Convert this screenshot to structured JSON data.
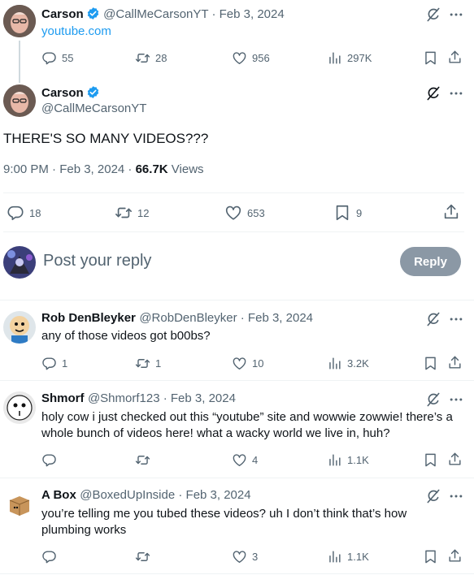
{
  "colors": {
    "accent": "#1d9bf0",
    "muted": "#536471",
    "text": "#0f1419",
    "reply_button": "#8b98a5"
  },
  "parent_tweet": {
    "author_name": "Carson",
    "meta": "@CallMeCarsonYT · Feb 3, 2024",
    "text": "youtube.com",
    "replies": "55",
    "retweets": "28",
    "likes": "956",
    "views": "297K"
  },
  "main_tweet": {
    "author_name": "Carson",
    "handle": "@CallMeCarsonYT",
    "text": "THERE'S SO MANY VIDEOS???",
    "timestamp": "9:00 PM · Feb 3, 2024 · ",
    "views_count": "66.7K",
    "views_label": " Views",
    "replies": "18",
    "retweets": "12",
    "likes": "653",
    "bookmarks": "9"
  },
  "composer": {
    "placeholder": "Post your reply",
    "button_label": "Reply"
  },
  "replies": [
    {
      "author_name": "Rob DenBleyker",
      "meta": "@RobDenBleyker · Feb 3, 2024",
      "text": "any of those videos got b00bs?",
      "replies": "1",
      "retweets": "1",
      "likes": "10",
      "views": "3.2K"
    },
    {
      "author_name": "Shmorf",
      "meta": "@Shmorf123 · Feb 3, 2024",
      "text": "holy cow i just checked out this “youtube” site and wowwie zowwie! there’s a whole bunch of videos here! what a wacky world we live in, huh?",
      "replies": "",
      "retweets": "",
      "likes": "4",
      "views": "1.1K"
    },
    {
      "author_name": "A Box",
      "meta": "@BoxedUpInside · Feb 3, 2024",
      "text": "you’re telling me you tubed these videos? uh I don’t think that’s how plumbing works",
      "replies": "",
      "retweets": "",
      "likes": "3",
      "views": "1.1K"
    }
  ],
  "icons": [
    "verified-badge-icon",
    "grok-icon",
    "more-icon",
    "reply-icon",
    "retweet-icon",
    "like-icon",
    "views-icon",
    "bookmark-icon",
    "share-icon"
  ]
}
